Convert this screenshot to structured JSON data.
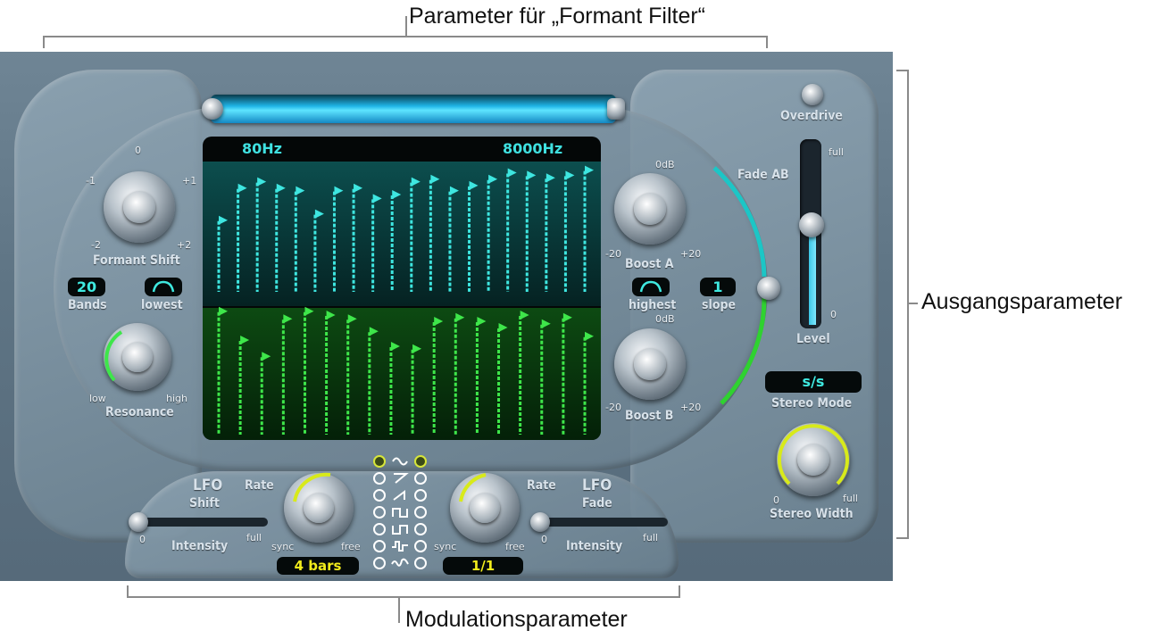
{
  "callouts": {
    "top": "Parameter für „Formant Filter“",
    "right": "Ausgangsparameter",
    "bottom": "Modulationsparameter"
  },
  "filter": {
    "low_freq": "80Hz",
    "high_freq": "8000Hz",
    "formant_shift_label": "Formant Shift",
    "formant_shift_ticks": {
      "zero": "0",
      "m1": "-1",
      "p1": "+1",
      "m2": "-2",
      "p2": "+2"
    },
    "bands_value": "20",
    "bands_label": "Bands",
    "lowest_label": "lowest",
    "resonance_label": "Resonance",
    "resonance_low": "low",
    "resonance_high": "high",
    "boost_a_label": "Boost A",
    "boost_b_label": "Boost B",
    "odb": "0dB",
    "minus20": "-20",
    "plus20": "+20",
    "highest_label": "highest",
    "slope_value": "1",
    "slope_label": "slope",
    "bands_a": [
      0.55,
      0.8,
      0.85,
      0.8,
      0.78,
      0.6,
      0.78,
      0.8,
      0.72,
      0.75,
      0.85,
      0.87,
      0.78,
      0.82,
      0.87,
      0.92,
      0.9,
      0.88,
      0.9,
      0.94
    ],
    "bands_b": [
      0.98,
      0.75,
      0.62,
      0.92,
      0.98,
      0.95,
      0.92,
      0.82,
      0.7,
      0.68,
      0.9,
      0.93,
      0.9,
      0.85,
      0.95,
      0.88,
      0.93,
      0.78
    ]
  },
  "output": {
    "overdrive_label": "Overdrive",
    "fade_ab_label": "Fade AB",
    "level_full": "full",
    "level_zero": "0",
    "level_label": "Level",
    "stereo_mode_value": "s/s",
    "stereo_mode_label": "Stereo Mode",
    "stereo_width_label": "Stereo Width",
    "stereo_width_zero": "0",
    "stereo_width_full": "full"
  },
  "modulation": {
    "lfo_shift_title": "LFO",
    "lfo_shift_sub": "Shift",
    "lfo_fade_title": "LFO",
    "lfo_fade_sub": "Fade",
    "rate_label": "Rate",
    "sync_label": "sync",
    "free_label": "free",
    "intensity_label": "Intensity",
    "zero": "0",
    "full": "full",
    "rate_shift_value": "4 bars",
    "rate_fade_value": "1/1",
    "waveforms": [
      "sine-wave-icon",
      "sawtooth-down-icon",
      "sawtooth-up-icon",
      "square-wave-icon",
      "square-inverted-icon",
      "random-step-icon",
      "random-smooth-icon"
    ],
    "active_waveform": 0
  }
}
